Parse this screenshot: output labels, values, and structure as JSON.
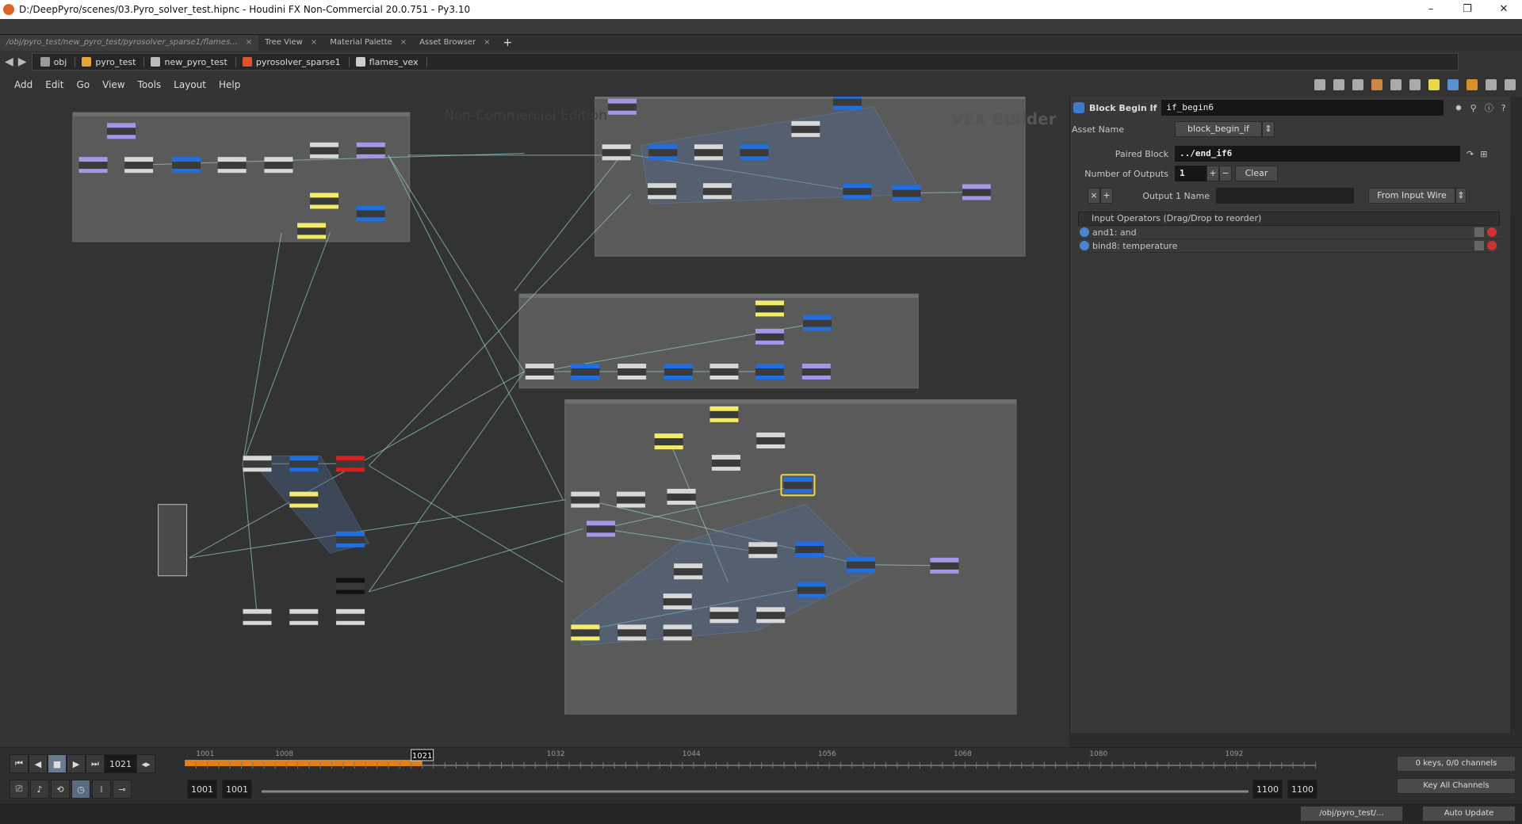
{
  "window": {
    "title": "D:/DeepPyro/scenes/03.Pyro_solver_test.hipnc - Houdini FX Non-Commercial 20.0.751 - Py3.10",
    "controls": [
      "–",
      "❐",
      "✕"
    ]
  },
  "tabs": [
    {
      "label": "/obj/pyro_test/new_pyro_test/pyrosolver_sparse1/flames...",
      "active": true
    },
    {
      "label": "Tree View"
    },
    {
      "label": "Material Palette"
    },
    {
      "label": "Asset Browser"
    }
  ],
  "tab_add": "+",
  "breadcrumb": [
    {
      "label": "obj",
      "color": "#9a9a9a"
    },
    {
      "label": "pyro_test",
      "color": "#e8a33a"
    },
    {
      "label": "new_pyro_test",
      "color": "#bbbbbb"
    },
    {
      "label": "pyrosolver_sparse1",
      "color": "#e0532a"
    },
    {
      "label": "flames_vex",
      "color": "#cccccc"
    }
  ],
  "menu": [
    "Add",
    "Edit",
    "Go",
    "View",
    "Tools",
    "Layout",
    "Help"
  ],
  "network": {
    "watermark": "Non-Commercial Edition",
    "context_label": "VEX Builder",
    "node_colors": {
      "p": "#a497ea",
      "w": "#d8d8d8",
      "b": "#1f6fe0",
      "y": "#f2ec6a",
      "r": "#d42020",
      "k": "#111111",
      "g": "#bdbdbd"
    },
    "selection_color": "#f2d83a"
  },
  "params": {
    "node_type": "Block Begin If",
    "node_name": "if_begin6",
    "asset_name_label": "Asset Name",
    "asset_name": "block_begin_if",
    "paired_block_label": "Paired Block",
    "paired_block": "../end_if6",
    "num_outputs_label": "Number of Outputs",
    "num_outputs": "1",
    "plus": "+",
    "minus": "−",
    "clear": "Clear",
    "output1_label": "Output 1 Name",
    "output1_value": "",
    "output1_mode": "From Input Wire",
    "inputs_header": "Input Operators (Drag/Drop to reorder)",
    "inputs": [
      "and1: and",
      "bind8: temperature"
    ]
  },
  "timeline": {
    "current_frame": "1021",
    "start": 1001,
    "end": 1100,
    "tick_labels": [
      1001,
      1008,
      1032,
      1044,
      1056,
      1068,
      1080,
      1092
    ],
    "range_start": "1001",
    "range_start2": "1001",
    "range_end": "1100",
    "range_end2": "1100",
    "keys_info": "0 keys, 0/0 channels",
    "key_all": "Key All Channels",
    "accent": "#e0801a"
  },
  "status": {
    "path": "/obj/pyro_test/...",
    "update_mode": "Auto Update"
  }
}
